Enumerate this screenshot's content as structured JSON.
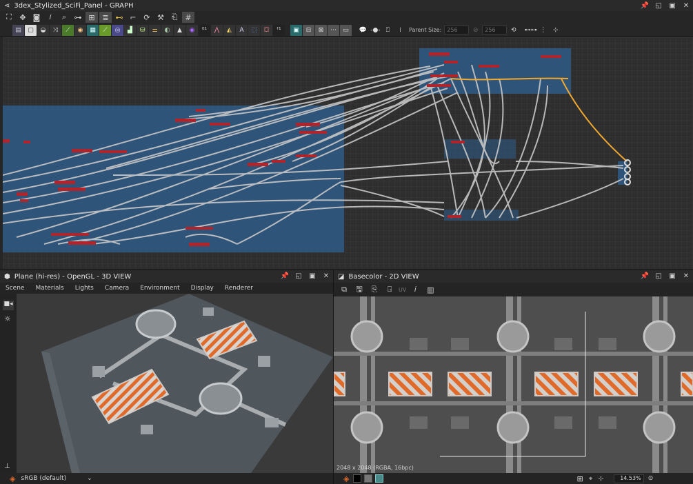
{
  "window": {
    "title": "3dex_Stylized_SciFi_Panel - GRAPH"
  },
  "graph_toolbar": {
    "parent_size_label": "Parent Size:",
    "parent_size_value": "256",
    "size_value": "256"
  },
  "view3d": {
    "title": "Plane (hi-res) - OpenGL - 3D VIEW",
    "menus": [
      "Scene",
      "Materials",
      "Lights",
      "Camera",
      "Environment",
      "Display",
      "Renderer"
    ],
    "colorspace": "sRGB (default)"
  },
  "view2d": {
    "title": "Basecolor - 2D VIEW",
    "uv_label": "UV",
    "resolution_info": "2048 x 2048 (RGBA, 16bpc)",
    "zoom": "14.53%"
  },
  "colors": {
    "frame_blue": "#2f5a86",
    "node_red": "#b0242c",
    "wire": "#c8c8c8",
    "wire_selected": "#f0a830",
    "hazard_orange": "#e06a2a"
  }
}
